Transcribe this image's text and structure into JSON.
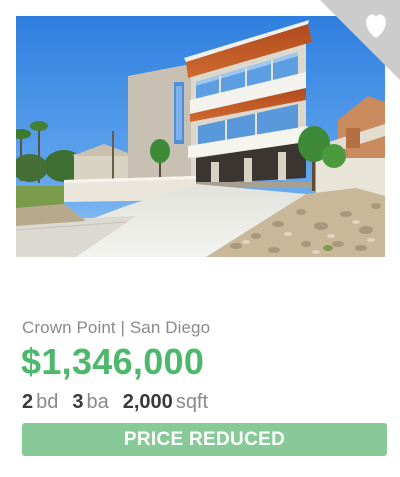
{
  "listing": {
    "location": "Crown Point | San Diego",
    "price": "$1,346,000",
    "beds": {
      "value": "2",
      "unit": "bd"
    },
    "baths": {
      "value": "3",
      "unit": "ba"
    },
    "area": {
      "value": "2,000",
      "unit": "sqft"
    },
    "badge": "PRICE REDUCED"
  },
  "favorite": {
    "icon": "heart-icon",
    "corner_color": "#cccccc",
    "icon_color": "#ffffff"
  },
  "photo": {
    "subject": "house-photo"
  },
  "colors": {
    "price": "#4cb86b",
    "badge_bg": "#87ca97",
    "muted_text": "#8a8a8a",
    "strong_text": "#3a3a3a"
  }
}
